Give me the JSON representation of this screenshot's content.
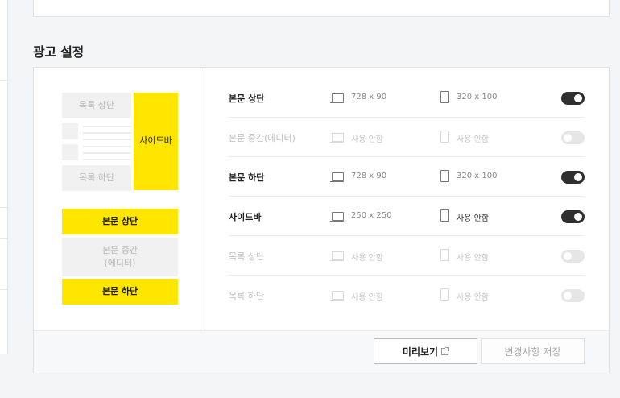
{
  "section_title": "광고 설정",
  "preview": {
    "list_top": "목록 상단",
    "list_bottom": "목록 하단",
    "sidebar": "사이드바",
    "body_top": "본문 상단",
    "body_middle_line1": "본문 중간",
    "body_middle_line2": "(에디터)",
    "body_bottom": "본문 하단"
  },
  "rows": [
    {
      "name": "본문 상단",
      "pc": "728 x 90",
      "mobile": "320 x 100",
      "enabled": true
    },
    {
      "name": "본문 중간(에디터)",
      "pc": "사용 안함",
      "mobile": "사용 안함",
      "enabled": false
    },
    {
      "name": "본문 하단",
      "pc": "728 x 90",
      "mobile": "320 x 100",
      "enabled": true
    },
    {
      "name": "사이드바",
      "pc": "250 x 250",
      "mobile": "사용 안함",
      "enabled": true
    },
    {
      "name": "목록 상단",
      "pc": "사용 안함",
      "mobile": "사용 안함",
      "enabled": false
    },
    {
      "name": "목록 하단",
      "pc": "사용 안함",
      "mobile": "사용 안함",
      "enabled": false
    }
  ],
  "buttons": {
    "preview": "미리보기",
    "save": "변경사항 저장"
  },
  "colors": {
    "accent_yellow": "#ffe600",
    "toggle_on": "#2f2f2f",
    "toggle_off": "#e6e6e6"
  }
}
